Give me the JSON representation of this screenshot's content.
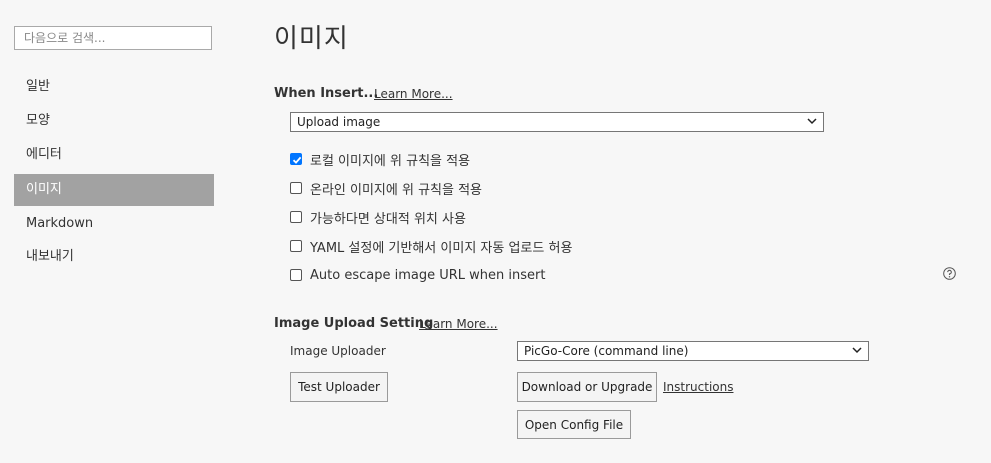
{
  "sidebar": {
    "search_placeholder": "다음으로 검색...",
    "items": [
      {
        "label": "일반"
      },
      {
        "label": "모양"
      },
      {
        "label": "에디터"
      },
      {
        "label": "이미지",
        "active": true
      },
      {
        "label": "Markdown"
      },
      {
        "label": "내보내기"
      }
    ]
  },
  "main": {
    "title": "이미지",
    "when_insert": {
      "heading": "When Insert...",
      "learn_more": "Learn More...",
      "select_value": "Upload image",
      "options": [
        {
          "label": "로컬 이미지에 위 규칙을 적용",
          "checked": true
        },
        {
          "label": "온라인 이미지에 위 규칙을 적용",
          "checked": false
        },
        {
          "label": "가능하다면 상대적 위치 사용",
          "checked": false
        },
        {
          "label": "YAML 설정에 기반해서 이미지 자동 업로드 허용",
          "checked": false
        },
        {
          "label": "Auto escape image URL when insert",
          "checked": false
        }
      ]
    },
    "upload": {
      "heading": "Image Upload Setting",
      "learn_more": "Learn More...",
      "uploader_label": "Image Uploader",
      "uploader_value": "PicGo-Core (command line)",
      "test_button": "Test Uploader",
      "download_button": "Download or Upgrade",
      "instructions_link": "Instructions",
      "open_config_button": "Open Config File"
    }
  },
  "colors": {
    "active_nav_bg": "#a2a2a2",
    "checkbox_accent": "#0075ff",
    "page_bg": "#f7f7f7"
  }
}
